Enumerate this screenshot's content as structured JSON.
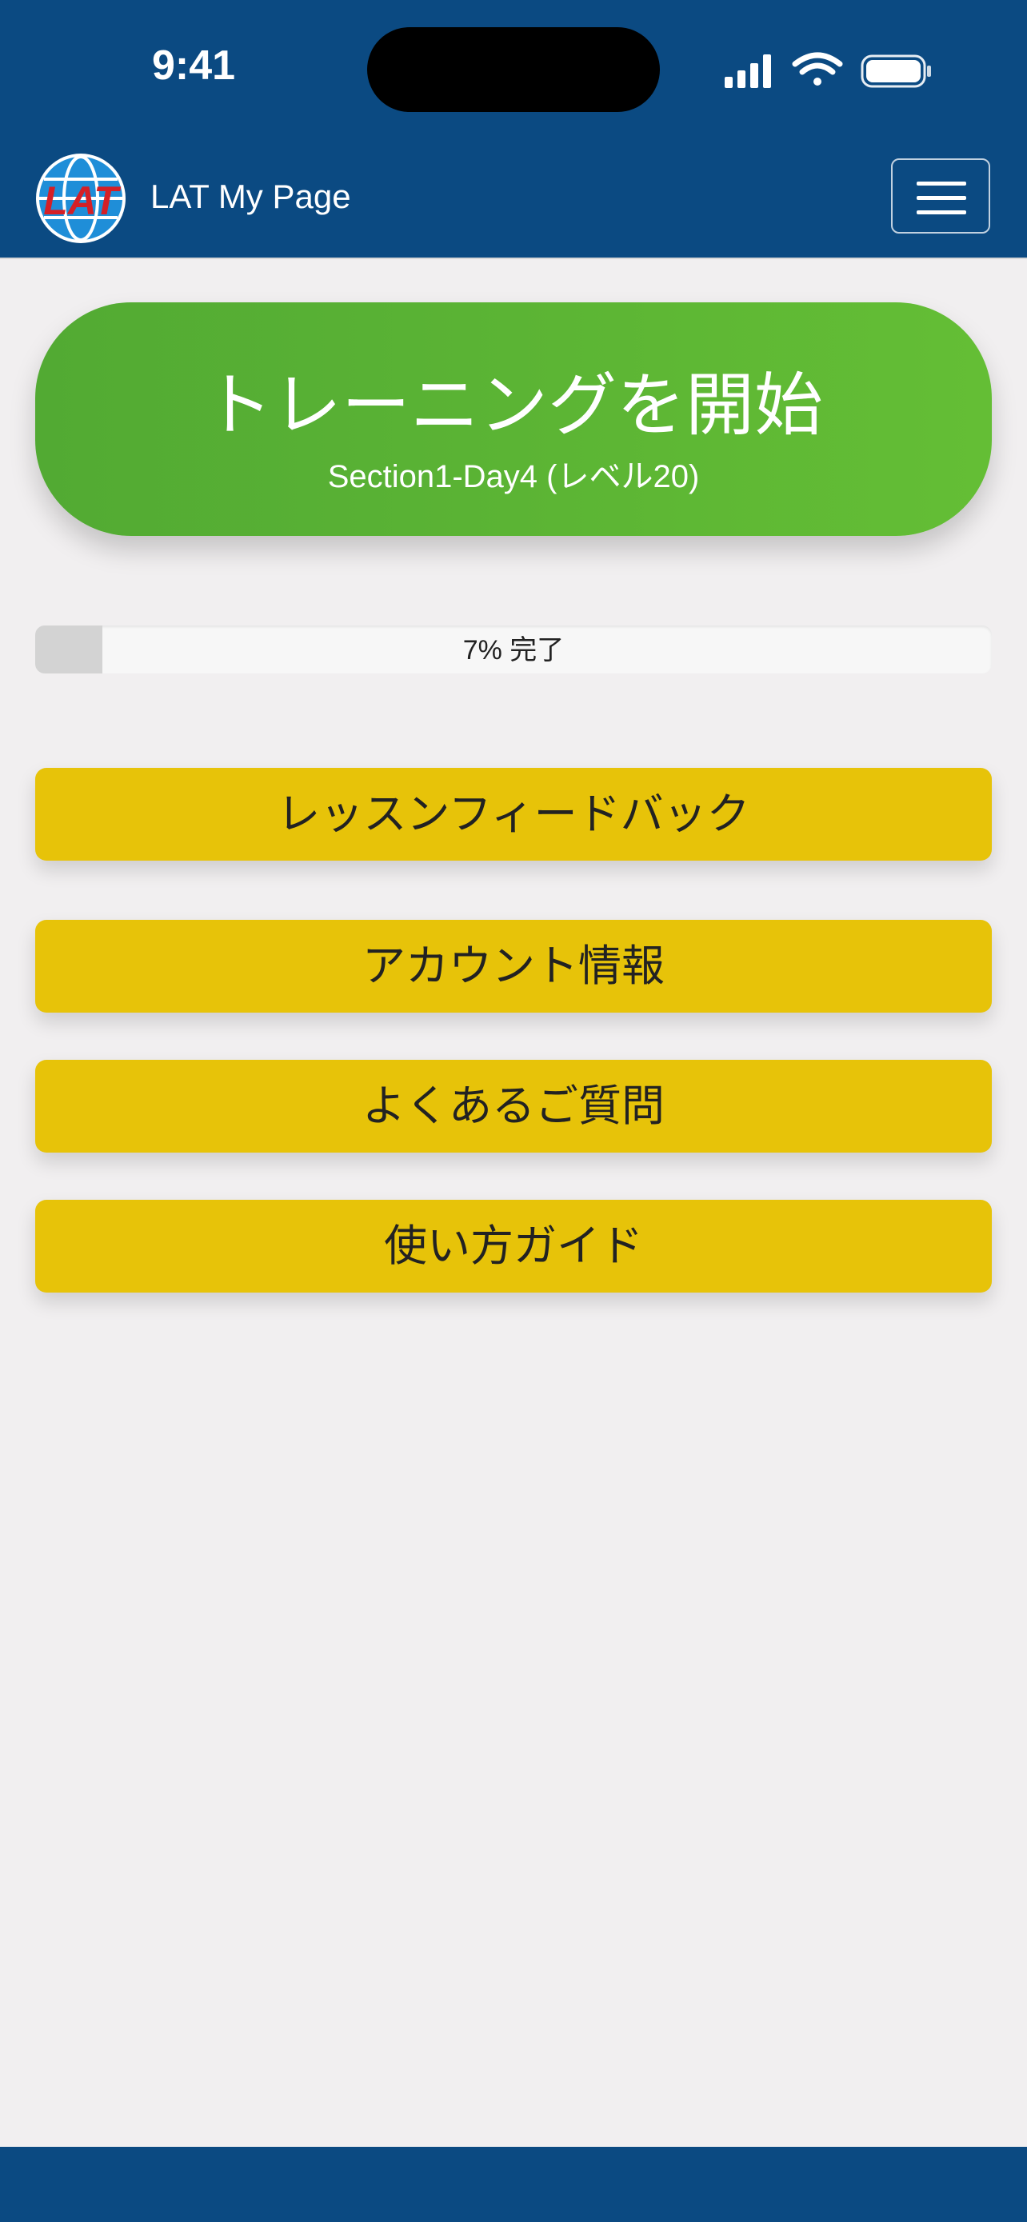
{
  "status": {
    "time": "9:41",
    "icons": [
      "signal-icon",
      "wifi-icon",
      "battery-icon"
    ]
  },
  "header": {
    "brand": "LAT My Page",
    "logo_text": "LAT",
    "menu_icon": "hamburger-icon"
  },
  "training": {
    "title": "トレーニングを開始",
    "subtitle": "Section1-Day4 (レベル20)"
  },
  "progress": {
    "percent": 7,
    "label": "7% 完了"
  },
  "menu": {
    "items": [
      {
        "label": "レッスンフィードバック"
      },
      {
        "label": "アカウント情報"
      },
      {
        "label": "よくあるご質問"
      },
      {
        "label": "使い方ガイド"
      }
    ]
  },
  "colors": {
    "nav_bg": "#0b4a82",
    "primary_green": "#5ab437",
    "button_yellow": "#e7c309",
    "page_bg": "#f1eff0"
  }
}
